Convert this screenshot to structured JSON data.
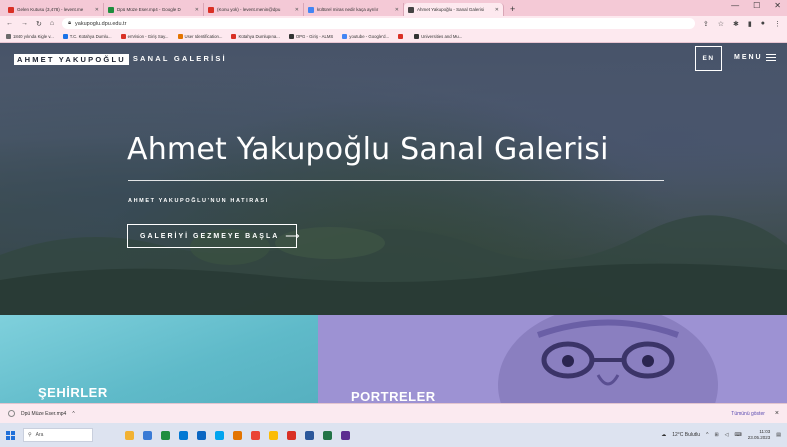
{
  "browser": {
    "tabs": [
      {
        "label": "Gelen Kutusu (3,478) - levent.me",
        "color": "#d93025",
        "active": false
      },
      {
        "label": "Dpü Müze Eser.mp4 - Google D",
        "color": "#1e8e3e",
        "active": false
      },
      {
        "label": "(Konu yok) - levent.menin@dpu",
        "color": "#d93025",
        "active": false
      },
      {
        "label": "kültürel miras nedir kaça ayrılır",
        "color": "#4285f4",
        "active": false
      },
      {
        "label": "Ahmet Yakupoğlu - Sanal Galerisi",
        "color": "#444444",
        "active": true
      }
    ],
    "new_tab": "+",
    "url": "yakupoglu.dpu.edu.tr",
    "bookmarks": [
      {
        "label": "1840 yılında Kigle v...",
        "color": "#6b6b6b"
      },
      {
        "label": "T.C. Kütahya Dumlu...",
        "color": "#1a73e8"
      },
      {
        "label": "enVision - Giriş Say...",
        "color": "#d93025"
      },
      {
        "label": "User Identification...",
        "color": "#e37400"
      },
      {
        "label": "Kütahya Dumlupına...",
        "color": "#d93025"
      },
      {
        "label": "OPG - Giriş - ALMS",
        "color": "#333333"
      },
      {
        "label": "youtube - Google'd...",
        "color": "#4285f4"
      },
      {
        "label": "",
        "color": "#d93025"
      },
      {
        "label": "Universities and Mu...",
        "color": "#333333"
      }
    ]
  },
  "site": {
    "brand_part1": "AHMET YAKUPOĞLU",
    "brand_part2": "SANAL GALERİSİ",
    "lang": "EN",
    "menu": "MENU",
    "title": "Ahmet Yakupoğlu Sanal Galerisi",
    "subtitle": "AHMET YAKUPOĞLU'NUN HATIRASI",
    "cta_label": "GALERİYİ GEZMEYE BAŞLA",
    "cta_arrow": "⟶",
    "card_left": "ŞEHİRLER",
    "card_right": "PORTRELER"
  },
  "download_bar": {
    "file": "Dpü Müze Eser.mp4",
    "caret": "^",
    "show_all": "Tümünü göster",
    "close": "×"
  },
  "taskbar": {
    "search_placeholder": "Ara",
    "weather": "12°C Bulutlu",
    "time": "11:03",
    "date": "23.05.2023",
    "icons": [
      "#f2b233",
      "#3a7bd5",
      "#1e8e3e",
      "#0078d4",
      "#0a66c2",
      "#00a4ef",
      "#e37400",
      "#ea4335",
      "#fbbc05",
      "#d93025",
      "#2b579a",
      "#217346",
      "#5c2d91"
    ]
  }
}
